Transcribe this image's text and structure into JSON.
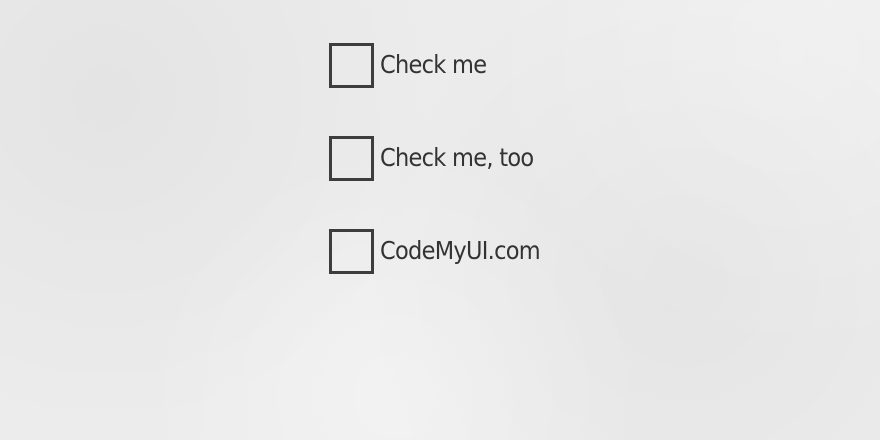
{
  "checkboxes": [
    {
      "label": "Check me",
      "checked": false
    },
    {
      "label": "Check me, too",
      "checked": false
    },
    {
      "label": "CodeMyUI.com",
      "checked": false
    }
  ],
  "colors": {
    "background": "#ececec",
    "box_border": "#3d3d3d",
    "text": "#333333"
  }
}
